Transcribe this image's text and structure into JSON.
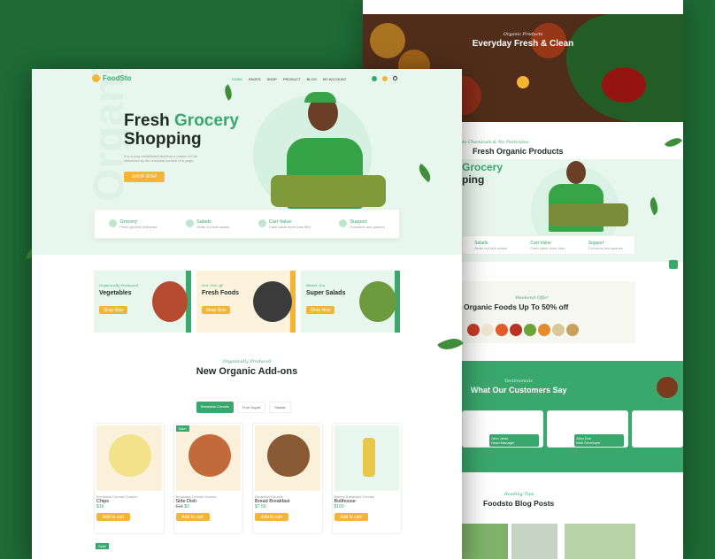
{
  "colors": {
    "bg": "#1e6b35",
    "accent": "#3aa76d",
    "yellow": "#f3b634",
    "mint": "#e8f7ee"
  },
  "back": {
    "hero_script": "Organic Products",
    "hero_title": "Everyday Fresh & Clean",
    "fresh_script": "No Chemicals & No Pesticides",
    "fresh_title": "Fresh Organic Products",
    "hero2_line1": "Grocery",
    "hero2_line2": "ping",
    "features": [
      {
        "title": "Salads",
        "text": "Order cut fruit salads"
      },
      {
        "title": "Cart Value",
        "text": "Cash value more than"
      },
      {
        "title": "Support",
        "text": "Concerns and queries"
      }
    ],
    "promo_script": "Weekend Offer",
    "promo_title": "Organic Foods Up To 50% off",
    "testimonials_script": "Testimonials",
    "testimonials_title": "What Our Customers Say",
    "reviewers": [
      {
        "name": "John Jessi",
        "role": "Head Manager"
      },
      {
        "name": "John Doe",
        "role": "Web Developer"
      }
    ],
    "blog_script": "Reading Tips",
    "blog_title": "Foodsto Blog Posts"
  },
  "front": {
    "logo": "FoodSto",
    "nav": [
      "HOME",
      "PAGES",
      "SHOP",
      "PRODUCT",
      "BLOG",
      "MY ACCOUNT"
    ],
    "watermark": "Organic",
    "hero_title_1": "Fresh",
    "hero_title_highlight": "Grocery",
    "hero_title_2": "Shopping",
    "hero_text": "It is a long established fact that a reader will be distracted by the readable content of a page.",
    "shop_now": "SHOP NOW",
    "features": [
      {
        "title": "Grocery",
        "text": "Fresh grocery delivered"
      },
      {
        "title": "Salads",
        "text": "Order cut fruit salads"
      },
      {
        "title": "Cart Value",
        "text": "Cash value more than $50"
      },
      {
        "title": "Support",
        "text": "Concerns and queries"
      }
    ],
    "categories": [
      {
        "script": "Organically Produced",
        "title": "Vegetables",
        "btn": "Shop Now"
      },
      {
        "script": "Get 25% off",
        "title": "Fresh Foods",
        "btn": "Shop Now"
      },
      {
        "script": "Better You",
        "title": "Super Salads",
        "btn": "Shop Now"
      }
    ],
    "addons_script": "Organically Produced",
    "addons_title": "New Organic Add-ons",
    "tabs": [
      "Breakfast Cereals",
      "Fruit Yogurt",
      "Salads"
    ],
    "products": [
      {
        "category": "Breakfast Cereals Snacks",
        "name": "Chips",
        "price": "$16",
        "old": "",
        "rating": "(0)",
        "badge": ""
      },
      {
        "category": "Breakfast Cereals Snacks",
        "name": "Side Dish",
        "price": "$3",
        "old": "$18",
        "rating": "(0)",
        "badge": "Sale!"
      },
      {
        "category": "Breakfast Cereals",
        "name": "Bread Breakfast",
        "price": "$7.50",
        "old": "",
        "rating": "(3)",
        "badge": ""
      },
      {
        "category": "Bakery Breakfast Cereals",
        "name": "Bolthouse",
        "price": "$100",
        "old": "",
        "rating": "(3)",
        "badge": ""
      }
    ],
    "add_to_cart": "Add to cart",
    "bottom_badge": "Sale!"
  }
}
